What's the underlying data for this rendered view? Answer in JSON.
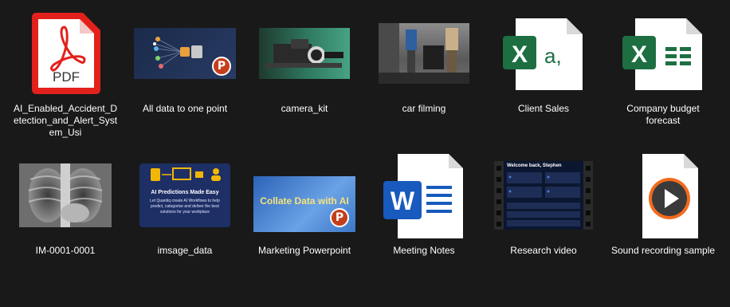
{
  "files": [
    {
      "name": "AI_Enabled_Accident_Detection_and_Alert_System_Usi",
      "icon": "pdf-icon",
      "badge": "PDF"
    },
    {
      "name": "All data to one point",
      "icon": "powerpoint-thumbnail"
    },
    {
      "name": "camera_kit",
      "icon": "image-thumbnail"
    },
    {
      "name": "car filming",
      "icon": "image-thumbnail"
    },
    {
      "name": "Client Sales",
      "icon": "excel-csv-icon",
      "letter": "X",
      "glyph": "a,"
    },
    {
      "name": "Company budget forecast",
      "icon": "excel-icon",
      "letter": "X"
    },
    {
      "name": "IM-0001-0001",
      "icon": "xray-image-thumbnail"
    },
    {
      "name": "imsage_data",
      "icon": "image-thumbnail",
      "thumb_title": "AI Predictions Made Easy",
      "thumb_text": "Let Quantiq create AI Workflows to help predict, categorise and deliver the best solutions for your workplace"
    },
    {
      "name": "Marketing Powerpoint",
      "icon": "powerpoint-thumbnail",
      "thumb_title": "Collate Data with AI"
    },
    {
      "name": "Meeting Notes",
      "icon": "word-icon",
      "letter": "W"
    },
    {
      "name": "Research video",
      "icon": "video-thumbnail",
      "thumb_title": "Welcome back, Stephen"
    },
    {
      "name": "Sound recording sample",
      "icon": "audio-icon"
    }
  ],
  "ppt_letter": "P",
  "colors": {
    "background": "#191919",
    "pdf": "#e2211c",
    "excel": "#1d6f42",
    "word": "#185abd",
    "powerpoint": "#c43e1c"
  }
}
